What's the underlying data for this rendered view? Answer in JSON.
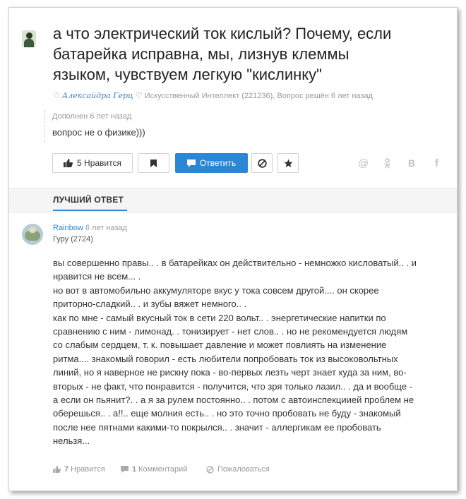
{
  "question": {
    "title_lines": [
      "а что электрический ток кислый? Почему, если",
      "батарейка исправна, мы, лизнув клеммы",
      "языком, чувствуем легкую \"кислинку\""
    ],
    "author": "Алексайдра Герц",
    "category": "Искусственный Интеллект (221236),",
    "status": "Вопрос решён 6 лет назад",
    "addendum_title": "Дополнен 6 лет назад",
    "addendum_text": "вопрос не о физике)))"
  },
  "actions": {
    "like_label": "5 Нравится",
    "answer_label": "Ответить"
  },
  "share": {
    "at": "@",
    "ok": "ok-icon",
    "vk": "В",
    "fb": "f"
  },
  "best_answer": {
    "tab_label": "ЛУЧШИЙ ОТВЕТ",
    "author_name": "Rainbow",
    "time": "6 лет назад",
    "rank": "Гуру (2724)",
    "body_lines": [
      "вы совершенно правы.. . в батарейках он действительно - немножко кисловатый.. . и",
      "нравится не всем... .",
      "но вот в автомобильно аккумуляторе вкус у тока совсем другой.... он скорее",
      "приторно-сладкий.. . и зубы вяжет немного.. .",
      "как по мне - самый вкусный ток в сети 220 вольт.. . энергетические напитки по",
      "сравнению с ним - лимонад. . тонизирует - нет слов.. . но не рекомендуется людям",
      "со слабым сердцем, т. к. повышает давление и может повлиять на изменение",
      "ритма.... знакомый говорил - есть любители попробовать ток из высоковольтных",
      "линий, но я наверное не рискну пока - во-первых лезть черт знает куда за ним, во-",
      "вторых - не факт, что понравится - получится, что зря только лазил.. . да и вообще -",
      "а если он пьянит?. . а я за рулем постоянно.. . потом с автоинспекциией проблем не",
      "оберешься.. . а!!.. еще молния есть.. . но это точно пробовать не буду - знакомый",
      "после нее пятнами какими-то покрылся.. . значит - аллергикам ее пробовать",
      "нельзя..."
    ],
    "likes_count": "7",
    "likes_label": "Нравится",
    "comments_count": "1",
    "comments_label": "Комментарий",
    "report_label": "Пожаловаться"
  },
  "colors": {
    "accent": "#2b86d4",
    "muted": "#999999"
  }
}
